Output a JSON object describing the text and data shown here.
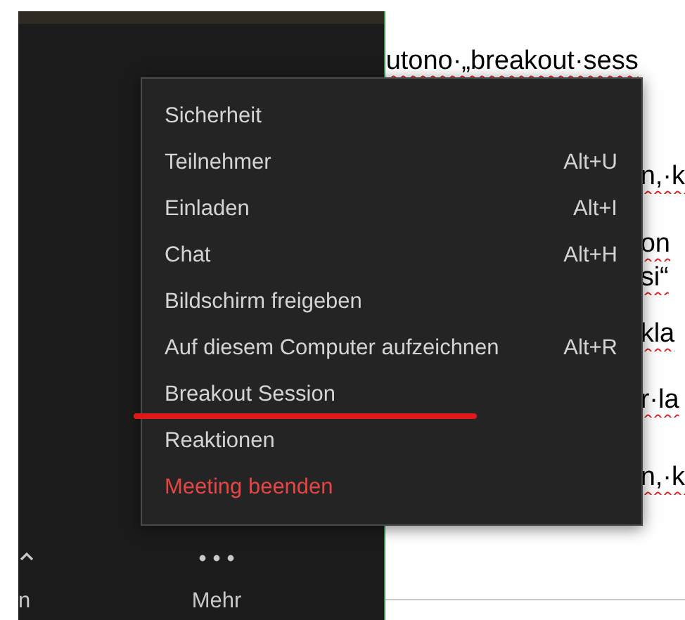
{
  "document": {
    "lines": [
      {
        "text": "utono·„breakout·sess",
        "misspelled": true
      },
      {
        "text": "n,·k",
        "misspelled": true
      },
      {
        "text": "on",
        "misspelled": true
      },
      {
        "text": "si“",
        "misspelled": true
      },
      {
        "text": "kla",
        "misspelled": true
      },
      {
        "text": "r·la",
        "misspelled": true
      },
      {
        "text": "n,·k",
        "misspelled": true
      }
    ]
  },
  "menu": {
    "items": [
      {
        "label": "Sicherheit",
        "kind": "normal"
      },
      {
        "label": "Teilnehmer",
        "shortcut": "Alt+U",
        "kind": "normal"
      },
      {
        "label": "Einladen",
        "shortcut": "Alt+I",
        "kind": "normal"
      },
      {
        "label": "Chat",
        "shortcut": "Alt+H",
        "kind": "normal"
      },
      {
        "label": "Bildschirm freigeben",
        "kind": "normal"
      },
      {
        "label": "Auf diesem Computer aufzeichnen",
        "shortcut": "Alt+R",
        "kind": "normal"
      },
      {
        "label": "Breakout Session",
        "kind": "normal",
        "underlined": true
      },
      {
        "label": "Reaktionen",
        "kind": "normal"
      },
      {
        "label": "Meeting beenden",
        "kind": "danger"
      }
    ]
  },
  "toolbar": [
    {
      "label": "n",
      "kind": "caret"
    },
    {
      "label": "Mehr",
      "kind": "dots"
    }
  ]
}
